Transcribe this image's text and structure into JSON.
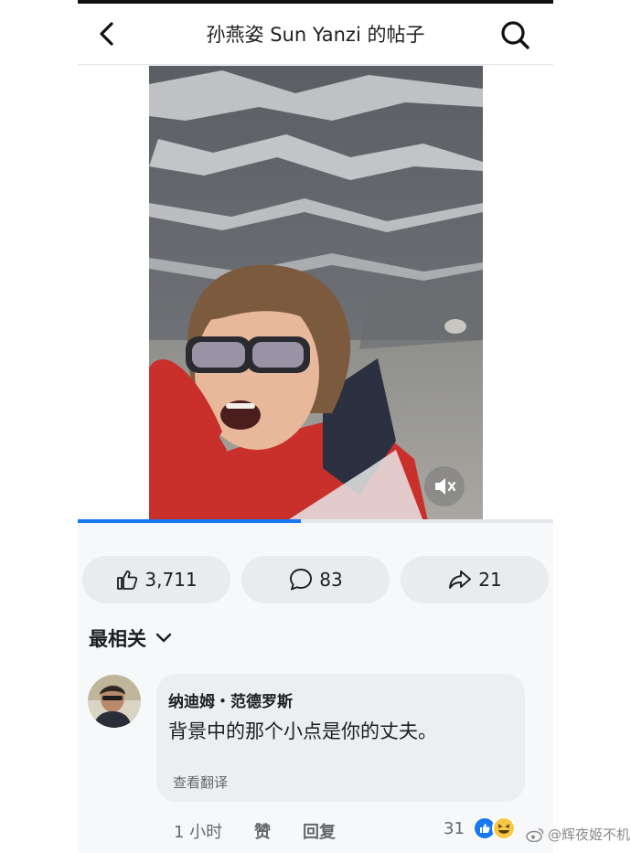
{
  "header": {
    "title": "孙燕姿 Sun Yanzi 的帖子",
    "back_icon": "chevron-left-icon",
    "search_icon": "search-icon"
  },
  "video": {
    "progress": 0.47,
    "mute_icon": "speaker-muted-icon"
  },
  "actions": {
    "likes": "3,711",
    "comments": "83",
    "shares": "21"
  },
  "sort": {
    "label": "最相关"
  },
  "comment": {
    "author": "纳迪姆・范德罗斯",
    "text": "背景中的那个小点是你的丈夫。",
    "translate_label": "查看翻译",
    "time": "1 小时",
    "like_label": "赞",
    "reply_label": "回复",
    "reaction_count": "31"
  },
  "watermark": {
    "text": "@辉夜姬不机"
  },
  "colors": {
    "accent": "#1877f2",
    "pill_bg": "#e9ebee",
    "bubble_bg": "#eceef1",
    "muted_text": "#65676b"
  }
}
